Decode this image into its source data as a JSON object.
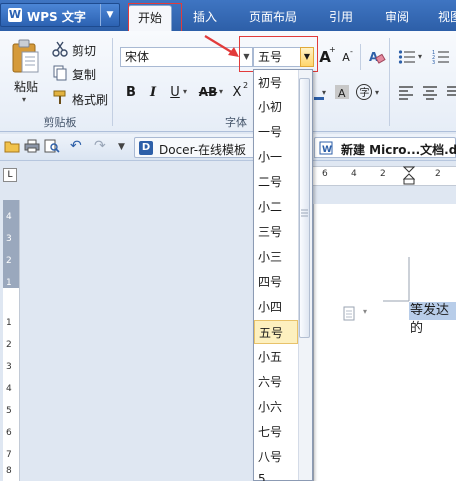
{
  "app": {
    "name": "WPS 文字",
    "logo": "W",
    "menu_arrow": "▼"
  },
  "tabs": [
    {
      "label": "开始",
      "active": true
    },
    {
      "label": "插入",
      "active": false
    },
    {
      "label": "页面布局",
      "active": false
    },
    {
      "label": "引用",
      "active": false
    },
    {
      "label": "审阅",
      "active": false
    },
    {
      "label": "视图",
      "active": false
    }
  ],
  "clipboard": {
    "paste_label": "粘贴",
    "cut_label": "剪切",
    "copy_label": "复制",
    "format_painter_label": "格式刷",
    "group_label": "剪贴板"
  },
  "font": {
    "name_value": "宋体",
    "size_value": "五号",
    "group_label": "字体",
    "bold": "B",
    "italic": "I",
    "underline": "U",
    "strikethrough": "AB",
    "superscript": "X",
    "grow": "A",
    "shrink": "A"
  },
  "font_size_options": [
    "初号",
    "小初",
    "一号",
    "小一",
    "二号",
    "小二",
    "三号",
    "小三",
    "四号",
    "小四",
    "五号",
    "小五",
    "六号",
    "小六",
    "七号",
    "八号",
    "5"
  ],
  "selected_size": "五号",
  "toolbar": {
    "docer_tab_label": "Docer-在线模板",
    "doc_tab_label": "新建 Micro...文档.doc"
  },
  "ruler": {
    "corner": "L",
    "h_numbers": [
      "6",
      "4",
      "2",
      "2"
    ],
    "v_numbers": [
      "4",
      "3",
      "2",
      "1",
      "1",
      "2",
      "3",
      "4",
      "5",
      "6",
      "7",
      "8"
    ]
  },
  "document": {
    "selected_text": "等发达的"
  },
  "colors": {
    "tab_bar": "#2d5fa8",
    "annotation_red": "#e23b3b",
    "selected_item": "#fdf0bf",
    "text_selection": "#b8cde9"
  }
}
